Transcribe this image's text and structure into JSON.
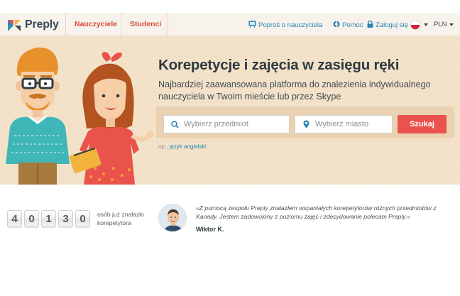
{
  "brand": {
    "name": "Preply",
    "accent": "#d94b3c",
    "link": "#2b84b3",
    "button": "#e9534b"
  },
  "nav": {
    "tabs": [
      {
        "label": "Nauczyciele"
      },
      {
        "label": "Studenci"
      }
    ],
    "request_teacher": "Poproś o nauczyciela",
    "help": "Pomoc",
    "login": "Zaloguj się",
    "language_icon": "poland-flag-icon",
    "currency": "PLN"
  },
  "hero": {
    "title": "Korepetycje i zajęcia w zasięgu ręki",
    "subtitle": "Najbardziej zaawansowana platforma do znalezienia indywidualnego nauczyciela w Twoim mieście lub przez Skype",
    "search": {
      "subject_placeholder": "Wybierz przedmiot",
      "city_placeholder": "Wybierz miasto",
      "button": "Szukaj"
    },
    "example_prefix": "np.,",
    "example_link": "język angielski"
  },
  "stats": {
    "digits": [
      "4",
      "0",
      "1",
      "3",
      "0"
    ],
    "label": "osób już znalazło korepetytora"
  },
  "testimonial": {
    "quote": "«Z pomocą zespołu Preply znalazłem wspaniałych korepetytorów różnych przedmiotów z Kanady. Jestem zadowolony z poziomu zajęć i zdecydowanie polecam Preply.»",
    "author": "Wiktor K."
  }
}
